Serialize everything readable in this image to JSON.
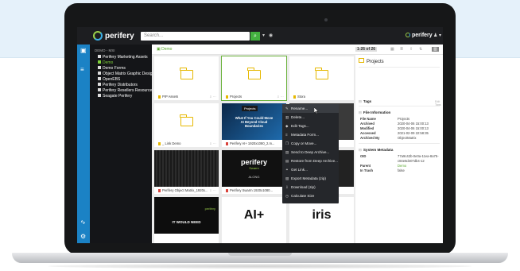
{
  "app": {
    "brand": "perifery",
    "search_placeholder": "Search...",
    "user_icon": "user-icon"
  },
  "tree": {
    "root": "DEMO - MSI",
    "items": [
      {
        "label": "Perifery Marketing Assets",
        "active": false
      },
      {
        "label": "Demo",
        "active": true
      },
      {
        "label": "Demo Forms",
        "active": false
      },
      {
        "label": "Object Matrix Graphic Design",
        "active": false
      },
      {
        "label": "OpenEBS",
        "active": false
      },
      {
        "label": "Perifery Distributors",
        "active": false
      },
      {
        "label": "Perifery Resellers Resources",
        "active": false
      },
      {
        "label": "Seagate Perifery",
        "active": false
      }
    ]
  },
  "breadcrumb": "Demo",
  "toolbar": {
    "count": "1-26 of 26"
  },
  "grid": [
    {
      "name": "PIP Assets",
      "kind": "folder"
    },
    {
      "name": "Projects",
      "kind": "folder",
      "selected": true
    },
    {
      "name": "Stora",
      "kind": "folder"
    },
    {
      "name": "_ Link Demo",
      "kind": "folder"
    },
    {
      "name": "Perifery AI+ 1920x1080_2.m...",
      "kind": "video"
    },
    {
      "name": "",
      "kind": "video"
    },
    {
      "name": "Perifery Object Matrix_1920x...",
      "kind": "video"
    },
    {
      "name": "Perifery Swarm 1920x1080...",
      "kind": "video"
    },
    {
      "name": "",
      "kind": "video"
    },
    {
      "name": "",
      "kind": "video"
    },
    {
      "name": "",
      "kind": "image"
    },
    {
      "name": "",
      "kind": "image"
    }
  ],
  "thumbs": {
    "ai_promo": "What If You Could Move AI Beyond Cloud Boundaries",
    "swarm_logo": "perifery",
    "swarm_sub": "Swarm",
    "swarm_caption": "ALONG",
    "small_logo": "perifery",
    "would_need": "IT WOULD NEED",
    "ai_plus": "AI+",
    "iris": "iris"
  },
  "tooltip": "Projects",
  "context_menu": [
    {
      "label": "Rename...",
      "icon": "pencil-icon"
    },
    {
      "label": "Delete...",
      "icon": "trash-icon"
    },
    {
      "label": "Edit Tags...",
      "icon": "tag-icon"
    },
    {
      "label": "Metadata Form...",
      "icon": "form-icon"
    },
    {
      "label": "Copy or Move...",
      "icon": "copy-icon"
    },
    {
      "label": "Send to Deep Archive...",
      "icon": "archive-icon"
    },
    {
      "label": "Restore from Deep Archive...",
      "icon": "restore-icon"
    },
    {
      "label": "Get Link...",
      "icon": "link-icon"
    },
    {
      "label": "Export Metadata (zip)",
      "icon": "export-icon"
    },
    {
      "label": "Download (zip)",
      "icon": "download-icon"
    },
    {
      "label": "Calculate Size",
      "icon": "calculator-icon"
    }
  ],
  "panel": {
    "title": "Projects",
    "tags_label": "Tags",
    "tags_hint": "Edit Tags",
    "file_info_label": "File Information",
    "file_info": [
      {
        "k": "File Name",
        "v": "Projects"
      },
      {
        "k": "Archived",
        "v": "2020-04-06 15:00:13"
      },
      {
        "k": "Modified",
        "v": "2020-04-06 15:00:13"
      },
      {
        "k": "Accessed",
        "v": "2021-02-09 22:58:35"
      },
      {
        "k": "Archived By",
        "v": "ObjectMatrix"
      }
    ],
    "sys_label": "System Metadata",
    "sys": [
      {
        "k": "OID",
        "v": "77a9c42b-0e0a-11ea-8a75-"
      },
      {
        "k": "",
        "v": "c84e8d407db4-12"
      },
      {
        "k": "Parent",
        "v": "Demo"
      },
      {
        "k": "In Trash",
        "v": "false"
      }
    ]
  }
}
